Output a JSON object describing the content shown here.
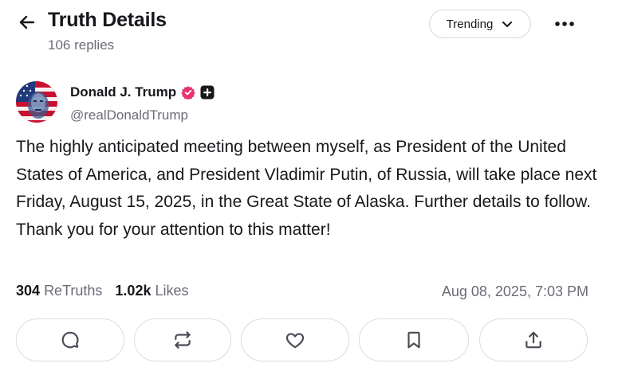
{
  "header": {
    "title": "Truth Details",
    "replies": "106 replies",
    "sort_label": "Trending"
  },
  "post": {
    "author_name": "Donald J. Trump",
    "handle": "@realDonaldTrump",
    "text": "The highly anticipated meeting between myself, as President of the United States of America, and President Vladimir Putin, of Russia, will take place next Friday, August 15, 2025, in the Great State of Alaska. Further details to follow. Thank you for your attention to this matter!",
    "retruths_count": "304",
    "retruths_label": "ReTruths",
    "likes_count": "1.02k",
    "likes_label": "Likes",
    "timestamp": "Aug 08, 2025, 7:03 PM"
  },
  "colors": {
    "verified_badge": "#e8336e",
    "text": "#17171c",
    "muted": "#6b6b78",
    "border": "#dcdce3"
  },
  "icons": [
    "back-arrow-icon",
    "chevron-down-icon",
    "more-icon",
    "verified-icon",
    "plus-badge-icon",
    "reply-icon",
    "retruth-icon",
    "like-icon",
    "bookmark-icon",
    "share-icon"
  ]
}
